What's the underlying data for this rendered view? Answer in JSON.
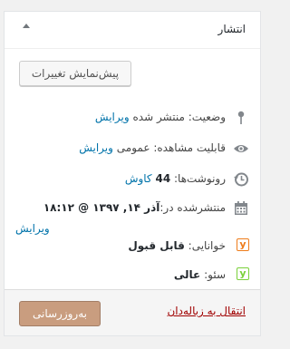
{
  "panel": {
    "title": "انتشار"
  },
  "preview_button": "پیش‌نمایش تغییرات",
  "status": {
    "label": "وضعیت:",
    "value": "منتشر شده",
    "edit": "ویرایش"
  },
  "visibility": {
    "label": "قابلیت مشاهده:",
    "value": "عمومی",
    "edit": "ویرایش"
  },
  "revisions": {
    "label": "رونوشت‌ها:",
    "count": "44",
    "link": "کاوش"
  },
  "published": {
    "label": "منتشرشده در:",
    "date": "آذر ۱۴, ۱۳۹۷ @ ۱۸:۱۲",
    "edit": "ویرایش"
  },
  "readability": {
    "label": "خوانایی:",
    "value": "قابل قبول",
    "color": "#ee7c1b"
  },
  "seo": {
    "label": "سئو:",
    "value": "عالی",
    "color": "#7ad03a"
  },
  "footer": {
    "trash": "انتقال به زباله‌دان",
    "update": "به‌روزرسانی"
  },
  "colors": {
    "link": "#0073aa",
    "trash": "#a00000",
    "primary_button": "#c99d7f"
  }
}
